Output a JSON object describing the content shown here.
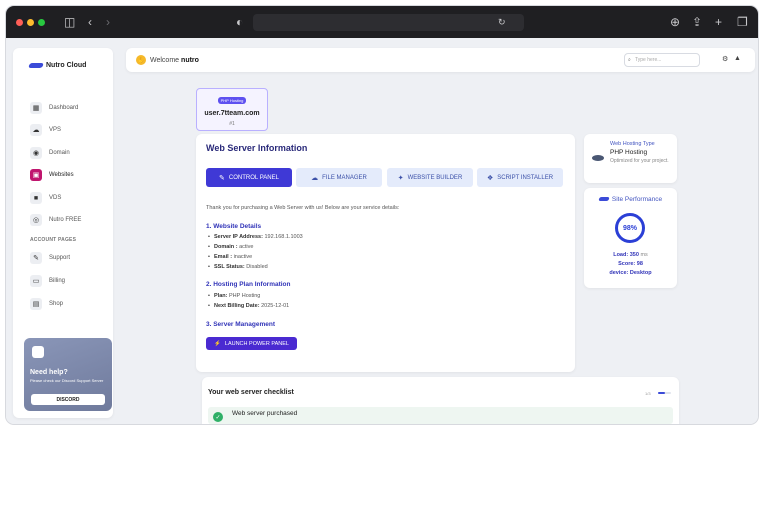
{
  "colors": {
    "accent": "#3f39d6",
    "active_nav": "#c0156e",
    "success": "#2fb067",
    "hosting_badge": "#5e50f0"
  },
  "browser": {
    "icons": [
      "sidebar-icon",
      "back-icon",
      "forward-icon",
      "shield-icon",
      "reload-icon",
      "download-icon",
      "share-icon",
      "new-tab-icon",
      "tabs-icon"
    ]
  },
  "sidebar": {
    "brand": "Nutro Cloud",
    "items": [
      {
        "label": "Dashboard",
        "icon": "home-icon",
        "glyph": "▦"
      },
      {
        "label": "VPS",
        "icon": "cloud-icon",
        "glyph": "☁"
      },
      {
        "label": "Domain",
        "icon": "globe-icon",
        "glyph": "◉"
      },
      {
        "label": "Websites",
        "icon": "monitor-icon",
        "glyph": "▣",
        "active": true
      },
      {
        "label": "VDS",
        "icon": "server-icon",
        "glyph": "■"
      },
      {
        "label": "Nutro FREE",
        "icon": "gift-icon",
        "glyph": "◎"
      }
    ],
    "section_label": "ACCOUNT PAGES",
    "account_items": [
      {
        "label": "Support",
        "icon": "support-icon",
        "glyph": "✎"
      },
      {
        "label": "Billing",
        "icon": "billing-icon",
        "glyph": "▭"
      },
      {
        "label": "Shop",
        "icon": "shop-icon",
        "glyph": "▤"
      }
    ],
    "help": {
      "title": "Need help?",
      "subtitle": "Please check our Discord Support Server",
      "button": "DISCORD"
    }
  },
  "topbar": {
    "welcome": "Welcome",
    "username": "nutro",
    "search_placeholder": "Type here..."
  },
  "hosting": {
    "badge": "PHP Hosting",
    "user": "user.7tteam.com",
    "number": "#1"
  },
  "main": {
    "title": "Web Server Information",
    "tabs": [
      {
        "label": "CONTROL PANEL",
        "icon": "tool-icon",
        "glyph": "✎",
        "active": true
      },
      {
        "label": "FILE MANAGER",
        "icon": "cloud-upload-icon",
        "glyph": "☁"
      },
      {
        "label": "WEBSITE BUILDER",
        "icon": "brush-icon",
        "glyph": "✦"
      },
      {
        "label": "SCRIPT INSTALLER",
        "icon": "cubes-icon",
        "glyph": "❖"
      }
    ],
    "intro": "Thank you for purchasing a Web Server with us! Below are your service details:",
    "section1": {
      "title": "1. Website Details",
      "items": [
        {
          "key": "Server IP Address:",
          "value": "192.168.1.1003"
        },
        {
          "key": "Domain :",
          "value": "active"
        },
        {
          "key": "Email :",
          "value": "inactive"
        },
        {
          "key": "SSL Status:",
          "value": "Disabled"
        }
      ]
    },
    "section2": {
      "title": "2. Hosting Plan Information",
      "items": [
        {
          "key": "Plan:",
          "value": "PHP Hosting"
        },
        {
          "key": "Next Billing Date:",
          "value": "2025-12-01"
        }
      ]
    },
    "section3": {
      "title": "3. Server Management",
      "button": "LAUNCH POWER PANEL"
    }
  },
  "type_card": {
    "label": "Web Hosting Type",
    "value": "PHP Hosting",
    "subtitle": "Optimized for your project."
  },
  "performance": {
    "title": "Site Performance",
    "score_pct": "98%",
    "load_label": "Load:",
    "load_value": "350",
    "load_unit": "ms",
    "score_label": "Score:",
    "score_value": "98",
    "device_label": "device:",
    "device_value": "Desktop"
  },
  "checklist": {
    "title": "Your web server checklist",
    "progress": "1/3",
    "progress_fraction": 0.5,
    "items": [
      {
        "label": "Web server purchased",
        "done": true
      }
    ]
  }
}
